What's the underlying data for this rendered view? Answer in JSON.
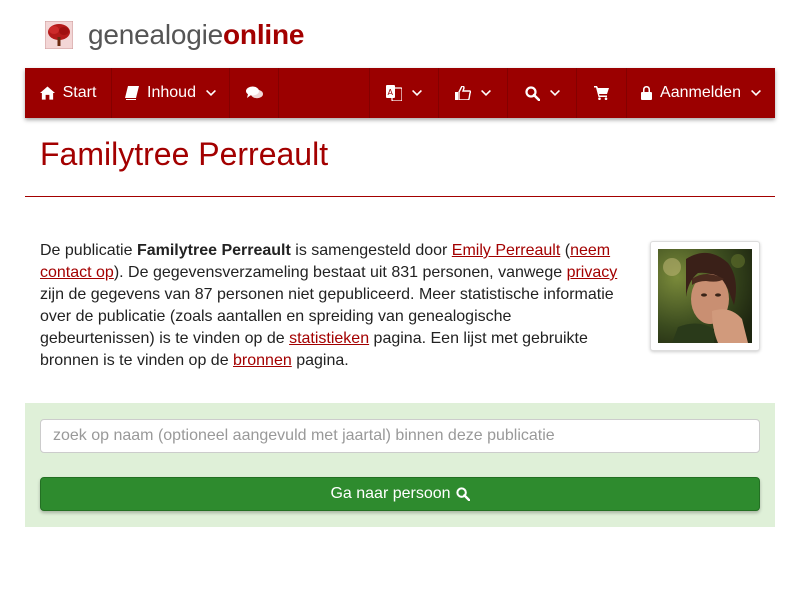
{
  "brand": {
    "part1": "genealogie",
    "part2": "online",
    "logo_icon": "tree-icon",
    "accent": "#a30000"
  },
  "nav": {
    "items": [
      {
        "label": "Start",
        "icon": "home-icon"
      },
      {
        "label": "Inhoud",
        "icon": "book-icon"
      },
      {
        "label": "",
        "icon": "comments-icon"
      },
      {
        "label": "",
        "icon": "translate-icon"
      },
      {
        "label": "",
        "icon": "thumbs-up-icon"
      },
      {
        "label": "",
        "icon": "search-icon"
      },
      {
        "label": "",
        "icon": "cart-icon"
      },
      {
        "label": "Aanmelden",
        "icon": "lock-icon"
      }
    ]
  },
  "page": {
    "title": "Familytree Perreault",
    "intro": {
      "t1": "De publicatie ",
      "pub_name": "Familytree Perreault",
      "t2": " is samengesteld door ",
      "author": "Emily Perreault",
      "t3": " (",
      "contact": "neem contact op",
      "t4": "). De gegevensverzameling bestaat uit 831 personen, vanwege ",
      "privacy": "privacy",
      "t5": " zijn de gegevens van 87 personen niet gepubliceerd. Meer statistische informatie over de publicatie (zoals aantallen en spreiding van genealogische gebeurtenissen) is te vinden op de ",
      "stats": "statistieken",
      "t6": " pagina. Een lijst met gebruikte bronnen is te vinden op de ",
      "sources": "bronnen",
      "t7": " pagina."
    }
  },
  "search": {
    "placeholder": "zoek op naam (optioneel aangevuld met jaartal) binnen deze publicatie",
    "button_label": "Ga naar persoon",
    "panel_color": "#dff0d8",
    "button_color": "#2e8b2e"
  }
}
